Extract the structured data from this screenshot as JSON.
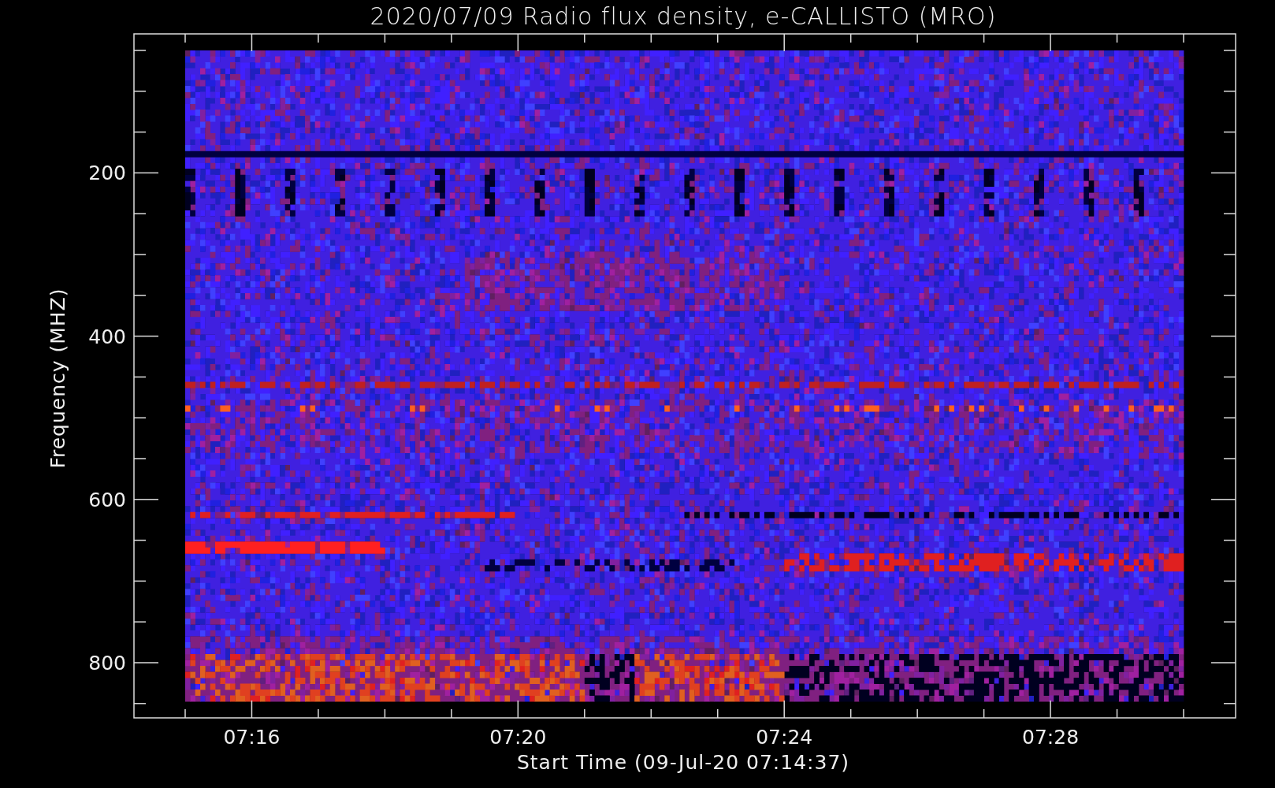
{
  "title": "2020/07/09  Radio flux density, e-CALLISTO (MRO)",
  "y_axis": {
    "label": "Frequency (MHZ)",
    "ticks": [
      "200",
      "400",
      "600",
      "800"
    ]
  },
  "x_axis": {
    "label": "Start Time (09-Jul-20 07:14:37)",
    "ticks": [
      "07:16",
      "07:20",
      "07:24",
      "07:28"
    ]
  }
}
